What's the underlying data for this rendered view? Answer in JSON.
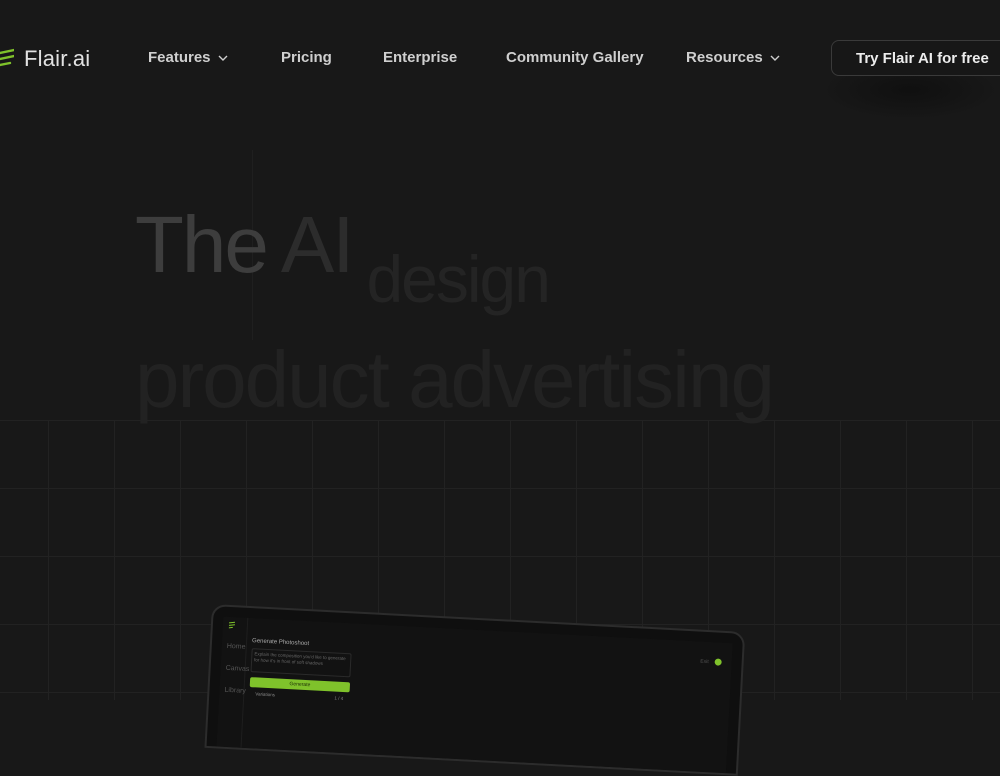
{
  "brand": {
    "name": "Flair.ai",
    "accent": "#7fc22b"
  },
  "nav": {
    "items": [
      {
        "label": "Features",
        "dropdown": true
      },
      {
        "label": "Pricing",
        "dropdown": false
      },
      {
        "label": "Enterprise",
        "dropdown": false
      },
      {
        "label": "Community Gallery",
        "dropdown": false
      },
      {
        "label": "Resources",
        "dropdown": true
      }
    ],
    "cta": "Try Flair AI  for free"
  },
  "hero": {
    "line1": [
      "The",
      "AI",
      "design"
    ],
    "line2": "product advertising"
  },
  "app_preview": {
    "panel_title": "Generate Photoshoot",
    "prompt_text": "Explain the composition you'd like to generate for how it's in front of soft shadows",
    "generate_label": "Generate",
    "variations_label": "Variations",
    "variations_value": "1 / 4",
    "top_right_label": "Exit",
    "sidebar": [
      "Home",
      "Canvas",
      "Library"
    ]
  }
}
